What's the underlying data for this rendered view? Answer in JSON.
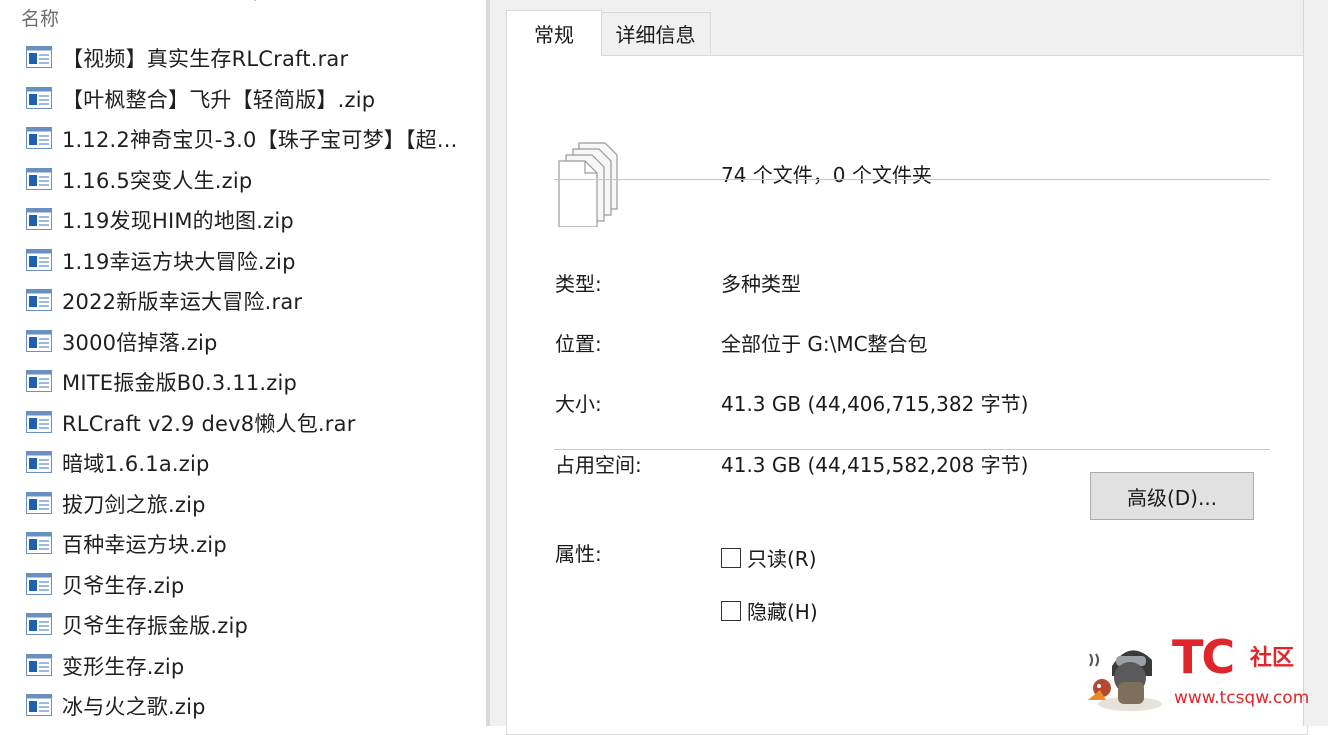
{
  "file_list": {
    "column_header": "名称",
    "items": [
      {
        "name": "【视频】真实生存RLCraft.rar"
      },
      {
        "name": "【叶枫整合】飞升【轻简版】.zip"
      },
      {
        "name": "1.12.2神奇宝贝-3.0【珠子宝可梦】【超..."
      },
      {
        "name": "1.16.5突变人生.zip"
      },
      {
        "name": "1.19发现HIM的地图.zip"
      },
      {
        "name": "1.19幸运方块大冒险.zip"
      },
      {
        "name": "2022新版幸运大冒险.rar"
      },
      {
        "name": "3000倍掉落.zip"
      },
      {
        "name": "MITE振金版B0.3.11.zip"
      },
      {
        "name": "RLCraft v2.9 dev8懒人包.rar"
      },
      {
        "name": "暗域1.6.1a.zip"
      },
      {
        "name": "拔刀剑之旅.zip"
      },
      {
        "name": "百种幸运方块.zip"
      },
      {
        "name": "贝爷生存.zip"
      },
      {
        "name": "贝爷生存振金版.zip"
      },
      {
        "name": "变形生存.zip"
      },
      {
        "name": "冰与火之歌.zip"
      }
    ]
  },
  "dialog": {
    "tabs": [
      {
        "label": "常规",
        "active": true
      },
      {
        "label": "详细信息",
        "active": false
      }
    ],
    "summary": "74 个文件，0 个文件夹",
    "properties": [
      {
        "label": "类型:",
        "value": "多种类型"
      },
      {
        "label": "位置:",
        "value": "全部位于 G:\\MC整合包"
      },
      {
        "label": "大小:",
        "value": "41.3 GB (44,406,715,382 字节)"
      },
      {
        "label": "占用空间:",
        "value": "41.3 GB (44,415,582,208 字节)"
      }
    ],
    "attributes": {
      "label": "属性:",
      "readonly_label": "只读(R)",
      "hidden_label": "隐藏(H)",
      "advanced_button": "高级(D)..."
    }
  },
  "watermark": {
    "brand": "TC",
    "community": "社区",
    "url": "www.tcsqw.com"
  },
  "colors": {
    "accent_red": "#e0262b",
    "dialog_bg": "#f0f0f0",
    "icon_blue": "#1e5fae"
  }
}
